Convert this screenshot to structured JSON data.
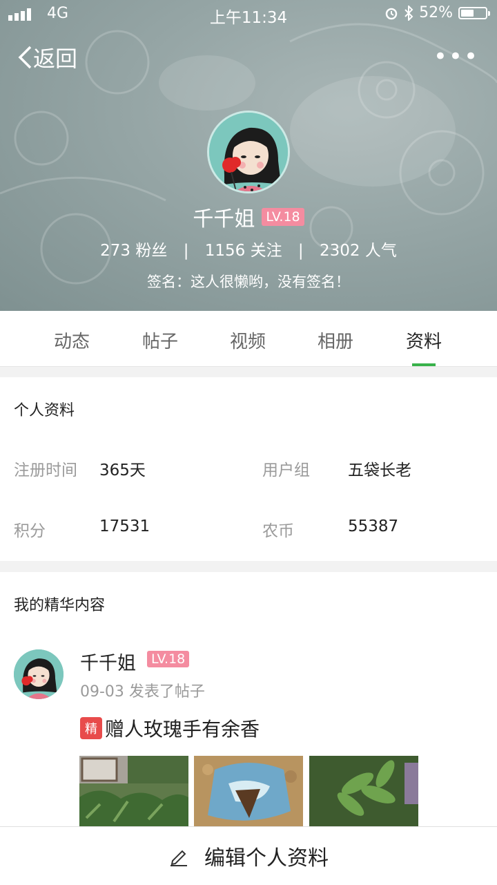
{
  "status_bar": {
    "network": "4G",
    "time": "上午11:34",
    "battery_percent": "52%",
    "battery_level": 0.52
  },
  "nav": {
    "back_label": "返回",
    "more_label": "•••"
  },
  "profile": {
    "name": "千千姐",
    "level": "LV.18",
    "fans": "273 粉丝",
    "following": "1156 关注",
    "popularity": "2302 人气",
    "stats_separator": "|",
    "signature": "签名：这人很懒哟，没有签名！"
  },
  "tabs": [
    {
      "label": "动态",
      "active": false
    },
    {
      "label": "帖子",
      "active": false
    },
    {
      "label": "视频",
      "active": false
    },
    {
      "label": "相册",
      "active": false
    },
    {
      "label": "资料",
      "active": true
    }
  ],
  "accent_color": "#38b24a",
  "personal_info": {
    "title": "个人资料",
    "fields": [
      {
        "label": "注册时间",
        "value": "365天"
      },
      {
        "label": "用户组",
        "value": "五袋长老"
      },
      {
        "label": "积分",
        "value": "17531"
      },
      {
        "label": "农币",
        "value": "55387"
      }
    ]
  },
  "featured": {
    "title": "我的精华内容",
    "post": {
      "author": "千千姐",
      "level": "LV.18",
      "meta": "09-03 发表了帖子",
      "badge": "精",
      "title": "赠人玫瑰手有余香"
    }
  },
  "bottom_bar": {
    "label": "编辑个人资料",
    "icon": "pencil-icon"
  }
}
